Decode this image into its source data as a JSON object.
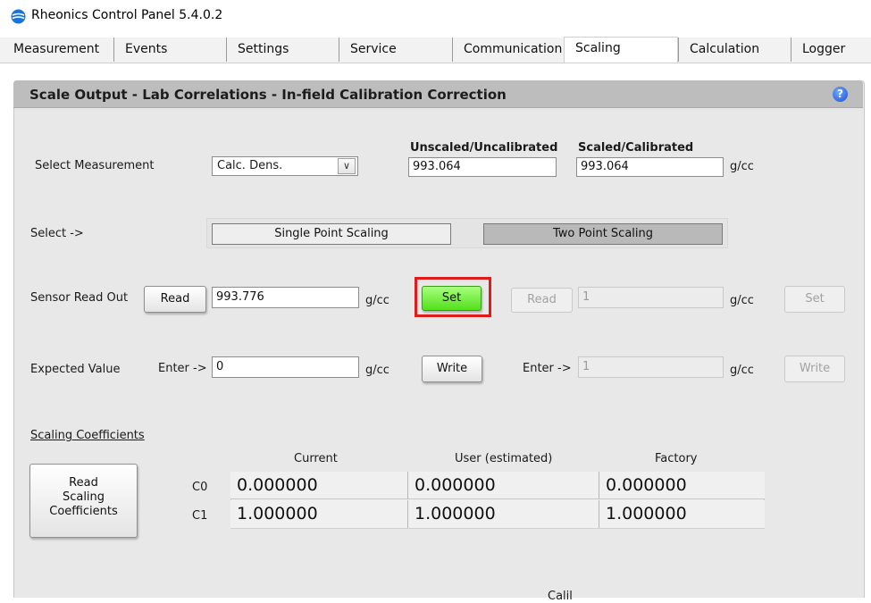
{
  "window": {
    "title": "Rheonics Control Panel 5.4.0.2"
  },
  "tabs": [
    {
      "label": "Measurement"
    },
    {
      "label": "Events"
    },
    {
      "label": "Settings"
    },
    {
      "label": "Service"
    },
    {
      "label": "Communication"
    },
    {
      "label": "Scaling"
    },
    {
      "label": "Calculation"
    },
    {
      "label": "Logger"
    }
  ],
  "active_tab": "Scaling",
  "panel": {
    "title": "Scale Output - Lab Correlations - In-field Calibration Correction",
    "help_glyph": "?",
    "select_measurement": {
      "label": "Select Measurement",
      "selected": "Calc. Dens.",
      "dropdown_glyph": "∨",
      "unscaled_header": "Unscaled/Uncalibrated",
      "scaled_header": "Scaled/Calibrated",
      "unscaled_value": "993.064",
      "scaled_value": "993.064",
      "unit": "g/cc"
    },
    "mode": {
      "label": "Select ->",
      "single_point": "Single Point Scaling",
      "two_point": "Two Point Scaling"
    },
    "sensor_readout": {
      "label": "Sensor Read Out",
      "read_button": "Read",
      "value": "993.776",
      "unit": "g/cc",
      "set_button": "Set",
      "read2_button": "Read",
      "value2": "1",
      "unit2": "g/cc",
      "set2_button": "Set"
    },
    "expected_value": {
      "label": "Expected Value",
      "enter_label": "Enter ->",
      "value": "0",
      "unit": "g/cc",
      "write_button": "Write",
      "enter2_label": "Enter ->",
      "value2": "1",
      "unit2": "g/cc",
      "write2_button": "Write"
    },
    "coefficients": {
      "link_label": "Scaling Coefficients",
      "read_button_lines": [
        "Read",
        "Scaling",
        "Coefficients"
      ],
      "columns": [
        "Current",
        "User (estimated)",
        "Factory"
      ],
      "rows": [
        {
          "label": "C0",
          "values": [
            "0.000000",
            "0.000000",
            "0.000000"
          ]
        },
        {
          "label": "C1",
          "values": [
            "1.000000",
            "1.000000",
            "1.000000"
          ]
        }
      ]
    },
    "bottom_fragment": "Calil"
  },
  "colors": {
    "panel_header": "#bdbdbd",
    "panel_bg": "#e8e8e8",
    "set_button_green": "#53e01c",
    "highlight_red": "#e01b1b"
  }
}
